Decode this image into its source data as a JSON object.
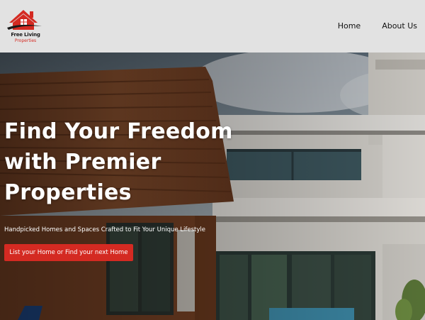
{
  "brand": {
    "name_line1": "Free Living",
    "name_line2": "Properties",
    "accent_color": "#d42a22"
  },
  "nav": {
    "items": [
      {
        "label": "Home"
      },
      {
        "label": "About Us"
      }
    ]
  },
  "hero": {
    "title": "Find Your Freedom with Premier Properties",
    "subtitle": "Handpicked Homes and Spaces Crafted to Fit Your Unique Lifestyle",
    "cta_label": "List your Home or Find your next Home",
    "background": "modern-house-photo"
  }
}
